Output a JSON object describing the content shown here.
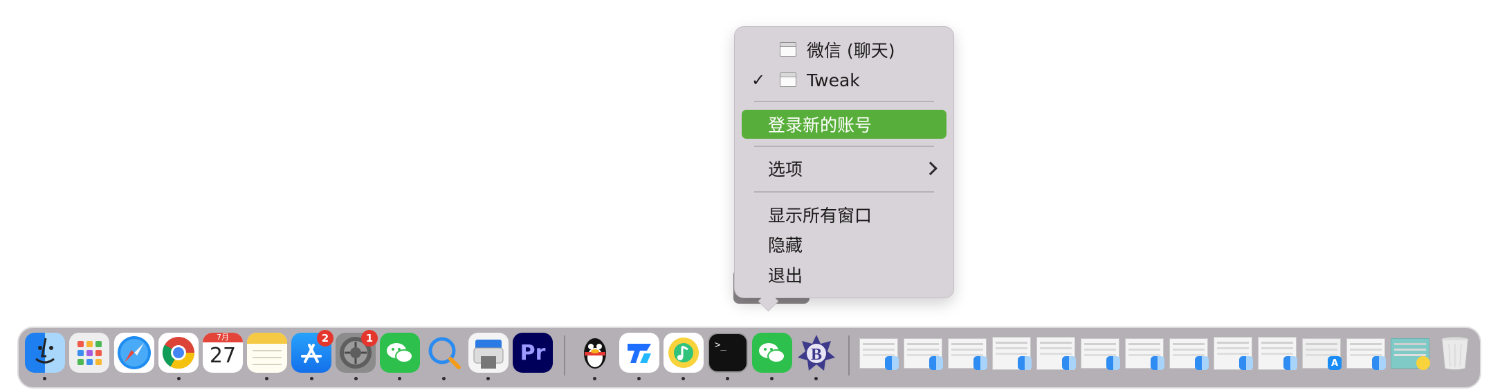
{
  "context_menu": {
    "windows": [
      {
        "label": "微信 (聊天)",
        "checked": false
      },
      {
        "label": "Tweak",
        "checked": true
      }
    ],
    "checkmark": "✓",
    "login_new_account": "登录新的账号",
    "options": "选项",
    "show_all_windows": "显示所有窗口",
    "hide": "隐藏",
    "quit": "退出",
    "highlight_color": "#58ae3a"
  },
  "dock": {
    "apps": [
      {
        "name": "Finder",
        "icon": "finder-icon",
        "running": true
      },
      {
        "name": "Launchpad",
        "icon": "launchpad-icon",
        "running": false
      },
      {
        "name": "Safari",
        "icon": "safari-icon",
        "running": false
      },
      {
        "name": "Google Chrome",
        "icon": "chrome-icon",
        "running": true
      },
      {
        "name": "Calendar",
        "icon": "calendar-icon",
        "running": false,
        "month": "7月",
        "day": "27"
      },
      {
        "name": "Notes",
        "icon": "notes-icon",
        "running": true
      },
      {
        "name": "App Store",
        "icon": "app-store-icon",
        "running": true,
        "badge": "2"
      },
      {
        "name": "System Preferences",
        "icon": "settings-icon",
        "running": true,
        "badge": "1"
      },
      {
        "name": "WeChat",
        "icon": "wechat-icon",
        "running": true
      },
      {
        "name": "Search",
        "icon": "search-app-icon",
        "running": true
      },
      {
        "name": "Printer",
        "icon": "printer-icon",
        "running": true
      },
      {
        "name": "Adobe Premiere Pro",
        "icon": "premiere-icon",
        "running": false,
        "label": "Pr"
      },
      {
        "name": "QQ",
        "icon": "qq-icon",
        "running": true
      },
      {
        "name": "Tencent Docs",
        "icon": "docs-icon",
        "running": true
      },
      {
        "name": "QQ Music",
        "icon": "qq-music-icon",
        "running": true
      },
      {
        "name": "Terminal",
        "icon": "terminal-icon",
        "running": true,
        "label": ">_"
      },
      {
        "name": "WeChat",
        "icon": "wechat-icon",
        "running": true
      },
      {
        "name": "BBEdit",
        "icon": "bbedit-icon",
        "running": true,
        "label": "B"
      }
    ],
    "minimized_window_count": 13,
    "trash": {
      "name": "Trash",
      "icon": "trash-icon"
    }
  }
}
